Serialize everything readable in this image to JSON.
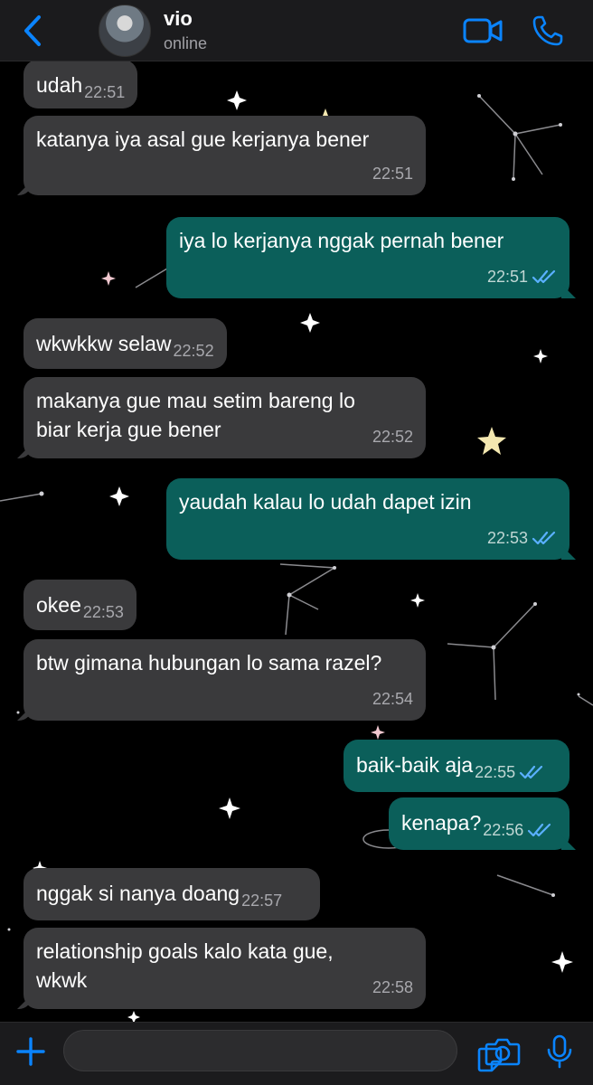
{
  "header": {
    "contact_name": "vio",
    "status": "online"
  },
  "messages": [
    {
      "dir": "in",
      "text": "udah",
      "time": "22:51"
    },
    {
      "dir": "in",
      "text": "katanya iya asal gue kerjanya bener",
      "time": "22:51"
    },
    {
      "dir": "out",
      "text": "iya lo kerjanya nggak pernah bener",
      "time": "22:51"
    },
    {
      "dir": "in",
      "text": "wkwkkw selaw",
      "time": "22:52"
    },
    {
      "dir": "in",
      "text": "makanya gue mau setim bareng lo biar kerja gue bener",
      "time": "22:52"
    },
    {
      "dir": "out",
      "text": "yaudah kalau lo udah dapet izin",
      "time": "22:53"
    },
    {
      "dir": "in",
      "text": "okee",
      "time": "22:53"
    },
    {
      "dir": "in",
      "text": "btw gimana hubungan lo sama razel?",
      "time": "22:54"
    },
    {
      "dir": "out",
      "text": "baik-baik aja",
      "time": "22:55"
    },
    {
      "dir": "out",
      "text": "kenapa?",
      "time": "22:56"
    },
    {
      "dir": "in",
      "text": "nggak si nanya doang",
      "time": "22:57"
    },
    {
      "dir": "in",
      "text": "relationship goals kalo kata gue, wkwk",
      "time": "22:58"
    }
  ],
  "colors": {
    "accent": "#0a84ff",
    "incoming_bubble": "#3a3a3c",
    "outgoing_bubble": "#0b5f5a"
  }
}
